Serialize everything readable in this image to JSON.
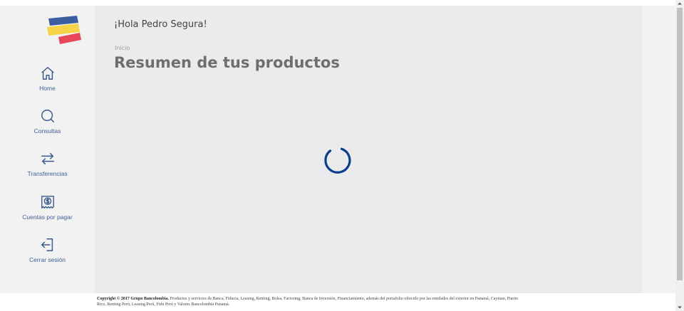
{
  "greeting": "¡Hola Pedro Segura!",
  "breadcrumb": "Inicio",
  "page_title": "Resumen de tus productos",
  "sidebar": {
    "items": [
      {
        "label": "Home",
        "icon": "home-icon"
      },
      {
        "label": "Consultas",
        "icon": "search-icon"
      },
      {
        "label": "Transferencias",
        "icon": "transfer-arrows-icon"
      },
      {
        "label": "Cuentas por pagar",
        "icon": "bill-dollar-icon"
      },
      {
        "label": "Cerrar sesión",
        "icon": "logout-icon"
      }
    ]
  },
  "footer": {
    "copyright_bold": "Copyright © 2017 Grupo Bancolombia.",
    "copyright_text": "Productos y servicios de Banca, Fiducia, Leasing, Renting, Bolsa, Factoring, Banca de Inversión, Financiamiento, además del portafolio ofrecido por las entidades del exterior en Panamá, Cayman, Puerto Rico, Renting Perú, Leasing Perú, Fidu Perú y Valores Bancolombia Panamá."
  },
  "colors": {
    "accent": "#0b3d8c",
    "nav_text": "#3d5f95",
    "logo_blue": "#3b5f9e",
    "logo_yellow": "#f5d547",
    "logo_red": "#e8475a"
  }
}
